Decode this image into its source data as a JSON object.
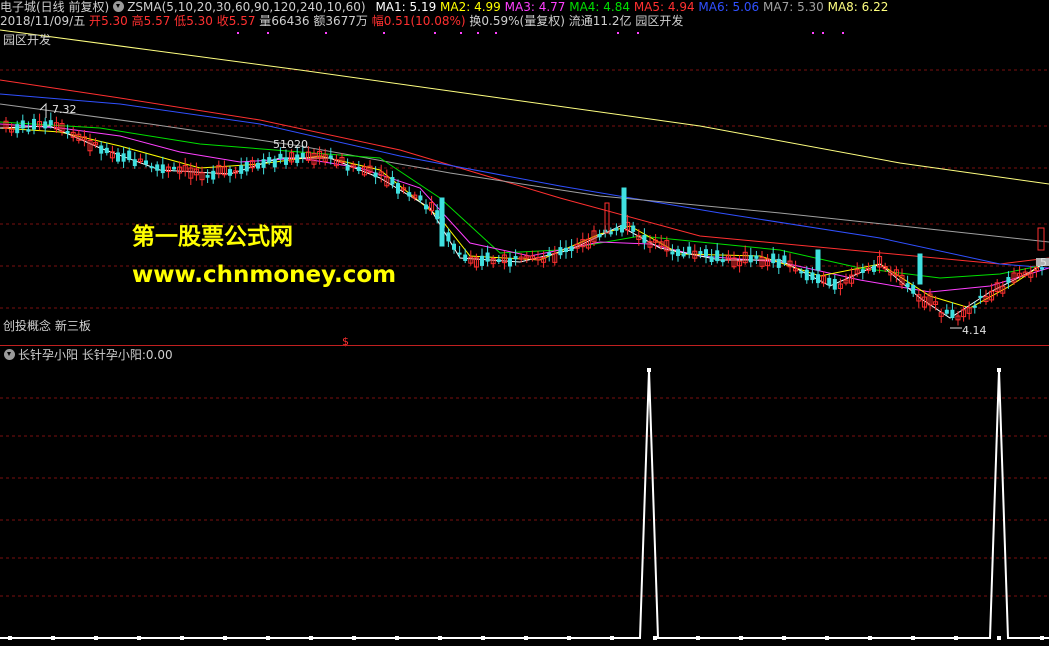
{
  "header": {
    "stock_name": "电子城(日线 前复权)",
    "indicator_name": "ZSMA(5,10,20,30,60,90,120,240,10,60)",
    "ma": [
      {
        "label": "MA1:",
        "value": "5.19",
        "color": "#ffffff"
      },
      {
        "label": "MA2:",
        "value": "4.99",
        "color": "#ffff00"
      },
      {
        "label": "MA3:",
        "value": "4.77",
        "color": "#ff40ff"
      },
      {
        "label": "MA4:",
        "value": "4.84",
        "color": "#00e000"
      },
      {
        "label": "MA5:",
        "value": "4.94",
        "color": "#ff3030"
      },
      {
        "label": "MA6:",
        "value": "5.06",
        "color": "#3050ff"
      },
      {
        "label": "MA7:",
        "value": "5.30",
        "color": "#a0a0a0"
      },
      {
        "label": "MA8:",
        "value": "6.22",
        "color": "#ffff80"
      }
    ]
  },
  "info": {
    "date": "2018/11/09/五",
    "open_label": "开",
    "open": "5.30",
    "high_label": "高",
    "high": "5.57",
    "low_label": "低",
    "low": "5.30",
    "close_label": "收",
    "close": "5.57",
    "volume_label": "量",
    "volume": "66436",
    "amount_label": "额",
    "amount": "3677万",
    "change_label": "幅",
    "change": "0.51(10.08%)",
    "turnover_label": "换",
    "turnover": "0.59%(量复权)",
    "float_label": "流通",
    "float": "11.2亿",
    "sector": "园区开发"
  },
  "chart": {
    "sector_label": "园区开发",
    "concept_label": "创投概念 新三板",
    "dividend_mark": "$",
    "annotations": {
      "high": "7.32",
      "mid": "51020",
      "low": "4.14",
      "right": "5"
    }
  },
  "watermark": {
    "line1": "第一股票公式网",
    "line2": "www.chnmoney.com"
  },
  "indicator": {
    "name": "长针孕小阳",
    "label": "长针孕小阳:",
    "value": "0.00"
  },
  "colors": {
    "up": "#ff3030",
    "down": "#40e0e0",
    "grid": "#7a1010",
    "ma_white": "#ffffff",
    "ma_yellow": "#ffff00",
    "ma_magenta": "#ff40ff",
    "ma_green": "#00e000",
    "ma_red": "#ff3030",
    "ma_blue": "#3050ff",
    "ma_gray": "#a0a0a0",
    "ma_lightyellow": "#ffff80"
  }
}
